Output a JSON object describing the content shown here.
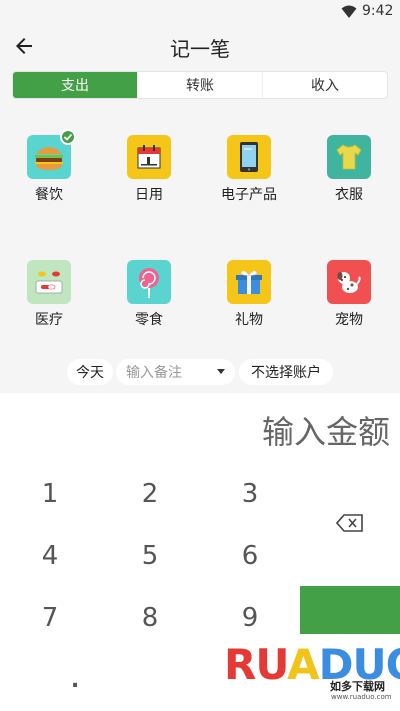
{
  "status_bar": {
    "time": "9:42"
  },
  "header": {
    "title": "记一笔"
  },
  "tabs": [
    {
      "label": "支出",
      "active": true
    },
    {
      "label": "转账",
      "active": false
    },
    {
      "label": "收入",
      "active": false
    }
  ],
  "categories": [
    {
      "label": "餐饮",
      "icon": "burger-icon",
      "bg": "#5ad4cf",
      "selected": true
    },
    {
      "label": "日用",
      "icon": "calendar-icon",
      "bg": "#f5c518",
      "selected": false
    },
    {
      "label": "电子产品",
      "icon": "phone-icon",
      "bg": "#f5c518",
      "selected": false
    },
    {
      "label": "衣服",
      "icon": "shirt-icon",
      "bg": "#3fb5a0",
      "selected": false
    },
    {
      "label": "医疗",
      "icon": "pills-icon",
      "bg": "#bfe6bf",
      "selected": false
    },
    {
      "label": "零食",
      "icon": "lollipop-icon",
      "bg": "#5ad4cf",
      "selected": false
    },
    {
      "label": "礼物",
      "icon": "gift-icon",
      "bg": "#f5c518",
      "selected": false
    },
    {
      "label": "宠物",
      "icon": "dog-icon",
      "bg": "#f05050",
      "selected": false
    }
  ],
  "meta": {
    "date": "今天",
    "note_placeholder": "输入备注",
    "account": "不选择账户"
  },
  "amount_placeholder": "输入金额",
  "keys": [
    "1",
    "2",
    "3",
    "4",
    "5",
    "6",
    "7",
    "8",
    "9",
    "."
  ],
  "watermark": {
    "logo": "RUADUO",
    "logo_r": "RU",
    "logo_u": "A",
    "logo_a": "DUO",
    "cn": "如多下载网",
    "url": "www.ruaduo.com"
  }
}
